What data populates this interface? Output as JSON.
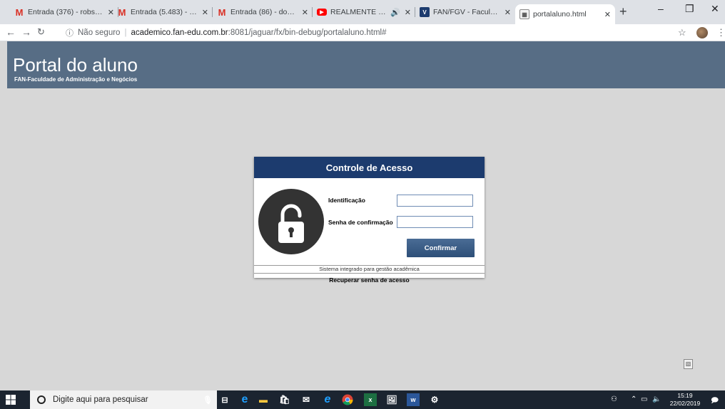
{
  "browser": {
    "tabs": [
      {
        "title": "Entrada (376) - robson.l",
        "icon": "gmail-icon"
      },
      {
        "title": "Entrada (5.483) - robson",
        "icon": "gmail-icon"
      },
      {
        "title": "Entrada (86) - donadeco",
        "icon": "gmail-icon"
      },
      {
        "title": "REALMENTE JESUS",
        "icon": "youtube-icon"
      },
      {
        "title": "FAN/FGV - Faculdade d",
        "icon": "fgv-icon"
      },
      {
        "title": "portalaluno.html",
        "icon": "page-icon"
      }
    ],
    "new_tab": "+",
    "controls": {
      "minimize": "–",
      "restore": "❐",
      "close": "✕"
    },
    "address": {
      "security": "Não seguro",
      "host": "academico.fan-edu.com.br",
      "path": ":8081/jaguar/fx/bin-debug/portalaluno.html#"
    }
  },
  "page": {
    "header": {
      "title": "Portal do aluno",
      "subtitle": "FAN-Faculdade de Administração e Negócios"
    },
    "login": {
      "title": "Controle de Acesso",
      "id_label": "Identificação",
      "id_value": "",
      "password_label": "Senha de confirmação",
      "password_value": "",
      "confirm_label": "Confirmar",
      "footer": "Sistema integrado para gestão acadêmica"
    },
    "recover_link": "Recuperar senha de acesso"
  },
  "taskbar": {
    "search_placeholder": "Digite aqui para pesquisar",
    "time": "15:19",
    "date": "22/02/2019"
  },
  "colors": {
    "header_bg": "#576d85",
    "dialog_header_bg": "#1c3b6e",
    "page_bg": "#d7d7d7",
    "button_bg": "#2d4f78"
  }
}
